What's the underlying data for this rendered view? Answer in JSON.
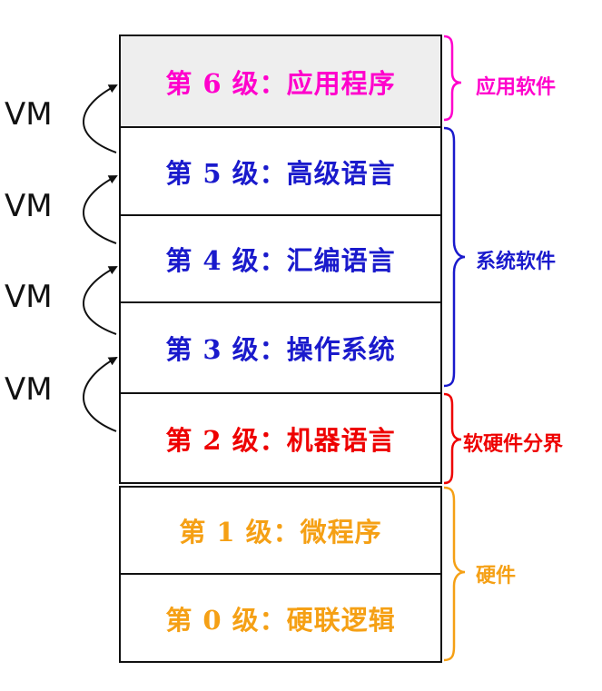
{
  "levels": [
    {
      "text": "第 6 级：应用程序",
      "color": "#ff00cc",
      "bg": "#eeeeee"
    },
    {
      "text": "第 5 级：高级语言",
      "color": "#1a1acc",
      "bg": "#ffffff"
    },
    {
      "text": "第 4 级：汇编语言",
      "color": "#1a1acc",
      "bg": "#ffffff"
    },
    {
      "text": "第 3 级：操作系统",
      "color": "#1a1acc",
      "bg": "#ffffff"
    },
    {
      "text": "第 2 级：机器语言",
      "color": "#ee0000",
      "bg": "#ffffff"
    },
    {
      "text": "第 1 级：微程序",
      "color": "#f5a015",
      "bg": "#ffffff"
    },
    {
      "text": "第 0 级：硬联逻辑",
      "color": "#f5a015",
      "bg": "#ffffff"
    }
  ],
  "vm_labels": [
    "VM",
    "VM",
    "VM",
    "VM"
  ],
  "groups": [
    {
      "label": "应用软件",
      "color": "#ff00cc"
    },
    {
      "label": "系统软件",
      "color": "#1a1acc"
    },
    {
      "label": "软硬件分界",
      "color": "#ee0000"
    },
    {
      "label": "硬件",
      "color": "#f5a015"
    }
  ]
}
